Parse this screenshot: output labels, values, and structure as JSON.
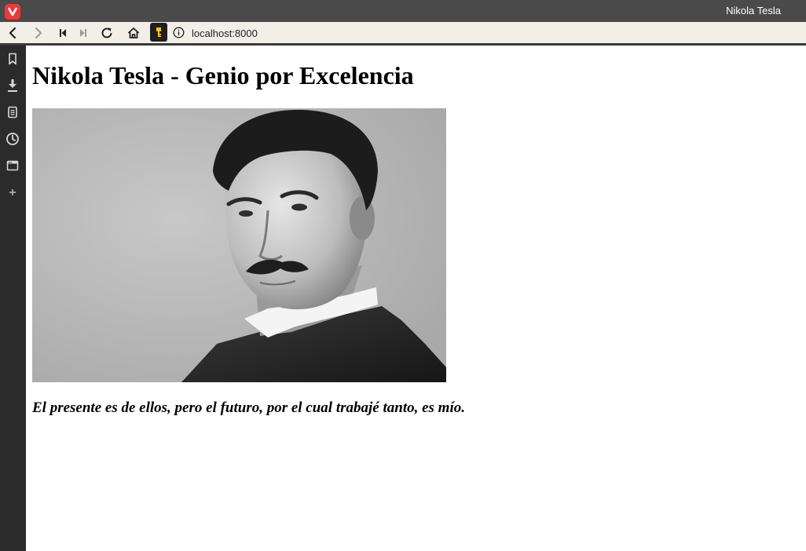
{
  "browser": {
    "window_title": "Nikola Tesla",
    "url": "localhost:8000",
    "colors": {
      "titlebar": "#4a4a4a",
      "navbar": "#f2efe9",
      "sidepanel": "#2b2b2b",
      "logo": "#ef3939",
      "key_icon": "#f5c518"
    },
    "nav_icons": [
      "back-icon",
      "forward-icon",
      "rewind-icon",
      "fast-forward-icon",
      "reload-icon",
      "home-icon"
    ],
    "side_icons": [
      "bookmarks-icon",
      "downloads-icon",
      "notes-icon",
      "history-icon",
      "window-panel-icon",
      "add-panel-icon"
    ]
  },
  "page": {
    "heading": "Nikola Tesla - Genio por Excelencia",
    "image": {
      "subject": "portrait-photo",
      "style": "black-and-white"
    },
    "quote": "El presente es de ellos, pero el futuro, por el cual trabajé tanto, es mío."
  }
}
